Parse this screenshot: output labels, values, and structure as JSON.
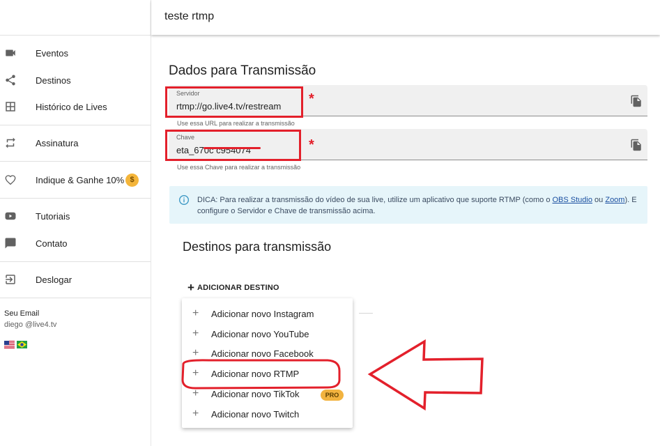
{
  "header": {
    "title": "teste rtmp"
  },
  "sidebar": {
    "items": [
      {
        "label": "Eventos",
        "icon": "video-camera-icon"
      },
      {
        "label": "Destinos",
        "icon": "share-icon"
      },
      {
        "label": "Histórico de Lives",
        "icon": "grid-icon"
      },
      {
        "label": "Assinatura",
        "icon": "repeat-icon"
      },
      {
        "label": "Indique & Ganhe 10%",
        "icon": "heart-icon",
        "badge": "$"
      },
      {
        "label": "Tutoriais",
        "icon": "youtube-icon"
      },
      {
        "label": "Contato",
        "icon": "chat-icon"
      },
      {
        "label": "Deslogar",
        "icon": "logout-icon"
      }
    ],
    "user": {
      "label": "Seu Email",
      "email": "diego @live4.tv"
    }
  },
  "transmission": {
    "title": "Dados para Transmissão",
    "server": {
      "label": "Servidor",
      "value": "rtmp://go.live4.tv/restream",
      "hint": "Use essa URL para realizar a transmissão"
    },
    "key": {
      "label": "Chave",
      "value": "eta_670c      c954074",
      "hint": "Use essa Chave para realizar a transmissão"
    },
    "required_mark": "*"
  },
  "tip": {
    "prefix": "DICA: Para realizar a transmissão do vídeo de sua live, utilize um aplicativo que suporte RTMP (como o ",
    "link1": "OBS Studio",
    "middle": " ou ",
    "link2": "Zoom",
    "suffix": "). E configure o Servidor e Chave de transmissão acima."
  },
  "destinations": {
    "title": "Destinos para transmissão",
    "add_button": "ADICIONAR DESTINO",
    "menu": [
      {
        "label": "Adicionar novo Instagram"
      },
      {
        "label": "Adicionar novo YouTube"
      },
      {
        "label": "Adicionar novo Facebook"
      },
      {
        "label": "Adicionar novo RTMP"
      },
      {
        "label": "Adicionar novo TikTok",
        "badge": "PRO"
      },
      {
        "label": "Adicionar novo Twitch"
      }
    ]
  },
  "colors": {
    "annotation_red": "#e3202b",
    "tip_bg": "#e6f5fa",
    "pro_badge": "#f2b33f"
  }
}
